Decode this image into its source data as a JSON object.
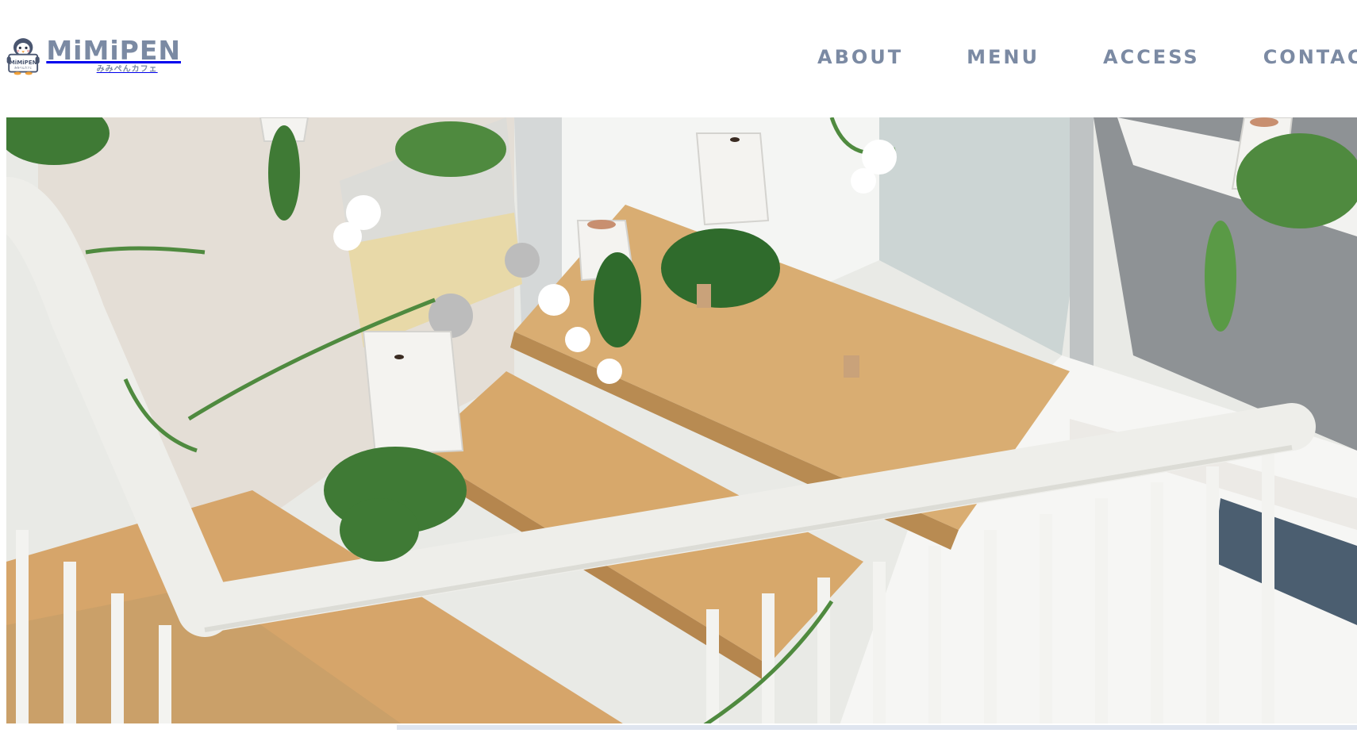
{
  "brand": {
    "name": "MiMiPEN",
    "subtitle": "みみぺんカフェ",
    "badge_text": "MiMiPEN",
    "badge_subtext": "みみぺんカフェ"
  },
  "nav": {
    "items": [
      {
        "label": "ABOUT"
      },
      {
        "label": "MENU"
      },
      {
        "label": "ACCESS"
      },
      {
        "label": "CONTACT"
      }
    ]
  },
  "colors": {
    "nav": "#7b8aa3",
    "background": "#ffffff",
    "wood": "#d9ad72",
    "railing": "#eeeeea",
    "foliage": "#3f7a35"
  },
  "hero": {
    "image_label": "cafe-interior-photo"
  }
}
